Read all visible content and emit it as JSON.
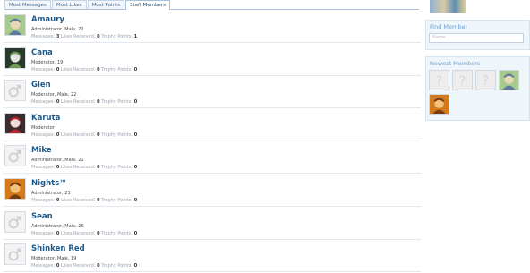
{
  "tabs": [
    {
      "label": "Most Messages",
      "active": false
    },
    {
      "label": "Most Likes",
      "active": false
    },
    {
      "label": "Most Points",
      "active": false
    },
    {
      "label": "Staff Members",
      "active": true
    }
  ],
  "stat_labels": {
    "messages": "Messages:",
    "likes": "Likes Received:",
    "trophy": "Trophy Points:"
  },
  "members": [
    {
      "name": "Amaury",
      "info": "Administrator, Male, 22",
      "messages": "3",
      "likes": "0",
      "trophy": "1",
      "avatar": "anime-character-green"
    },
    {
      "name": "Cana",
      "info": "Moderator, 19",
      "messages": "0",
      "likes": "0",
      "trophy": "0",
      "avatar": "anime-character-dark"
    },
    {
      "name": "Glen",
      "info": "Moderator, Male, 22",
      "messages": "0",
      "likes": "0",
      "trophy": "0",
      "avatar": "default-male"
    },
    {
      "name": "Karuta",
      "info": "Moderator",
      "messages": "0",
      "likes": "0",
      "trophy": "0",
      "avatar": "anime-character-red"
    },
    {
      "name": "Mike",
      "info": "Administrator, Male, 21",
      "messages": "0",
      "likes": "0",
      "trophy": "0",
      "avatar": "default-male"
    },
    {
      "name": "Nights™",
      "info": "Administrator, 21",
      "messages": "0",
      "likes": "0",
      "trophy": "0",
      "avatar": "anime-character-orange"
    },
    {
      "name": "Sean",
      "info": "Administrator, Male, 26",
      "messages": "0",
      "likes": "0",
      "trophy": "0",
      "avatar": "default-male"
    },
    {
      "name": "Shinken Red",
      "info": "Moderator, Male, 19",
      "messages": "0",
      "likes": "0",
      "trophy": "0",
      "avatar": "default-male"
    }
  ],
  "sidebar": {
    "find_member": {
      "title": "Find Member",
      "placeholder": "Name..."
    },
    "newest_members": {
      "title": "Newest Members",
      "avatars": [
        "default-unknown",
        "default-unknown",
        "default-unknown",
        "anime-character-green",
        "anime-character-orange"
      ]
    }
  },
  "colors": {
    "link": "#1e5a8c",
    "block_title": "#6f9fcf",
    "block_bg": "#eef5fb"
  }
}
